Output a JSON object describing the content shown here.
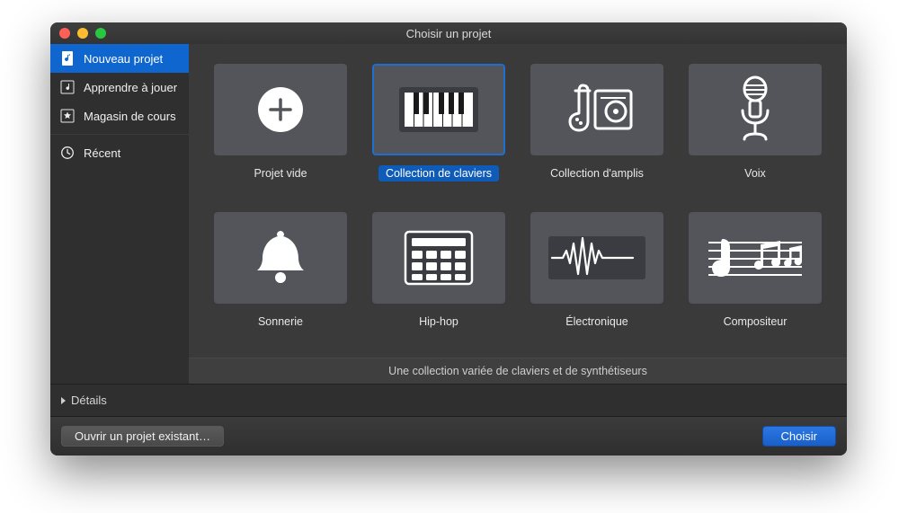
{
  "window": {
    "title": "Choisir un projet"
  },
  "sidebar": {
    "items": [
      {
        "label": "Nouveau projet",
        "icon": "music-doc"
      },
      {
        "label": "Apprendre à jouer",
        "icon": "note-box"
      },
      {
        "label": "Magasin de cours",
        "icon": "star-box"
      },
      {
        "label": "Récent",
        "icon": "clock"
      }
    ],
    "active_index": 0
  },
  "templates": {
    "items": [
      {
        "label": "Projet vide",
        "icon": "plus-circle"
      },
      {
        "label": "Collection de claviers",
        "icon": "keyboard"
      },
      {
        "label": "Collection d'amplis",
        "icon": "guitar-amp"
      },
      {
        "label": "Voix",
        "icon": "microphone"
      },
      {
        "label": "Sonnerie",
        "icon": "bell"
      },
      {
        "label": "Hip-hop",
        "icon": "drum-machine"
      },
      {
        "label": "Électronique",
        "icon": "waveform"
      },
      {
        "label": "Compositeur",
        "icon": "sheet-music"
      }
    ],
    "selected_index": 1,
    "description": "Une collection variée de claviers et de synthétiseurs"
  },
  "details": {
    "label": "Détails"
  },
  "footer": {
    "open_existing_label": "Ouvrir un projet existant…",
    "choose_label": "Choisir"
  }
}
